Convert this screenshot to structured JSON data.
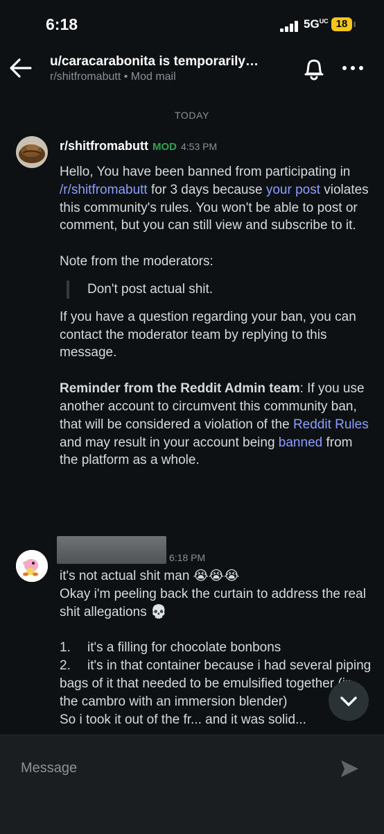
{
  "status_bar": {
    "time": "6:18",
    "network": "5G",
    "network_sup": "UC",
    "battery": "18"
  },
  "header": {
    "title": "u/caracarabonita is temporarily…",
    "subtitle": "r/shitfromabutt • Mod mail",
    "icons": [
      "back-arrow-icon",
      "bell-icon",
      "more-horizontal-icon"
    ]
  },
  "day_label": "TODAY",
  "messages": [
    {
      "sender": "r/shitfromabutt",
      "badge": "MOD",
      "time": "4:53 PM",
      "p1": {
        "t1": "Hello, You have been banned from participating in ",
        "link1": "/r/shitfromabutt",
        "t2": " for 3 days because ",
        "link2": "your post",
        "t3": " violates this community's rules. You won't be able to post or comment, but you can still view and subscribe to it."
      },
      "p2": "Note from the moderators:",
      "quote": "Don't post actual shit.",
      "p3": "If you have a question regarding your ban, you can contact the moderator team by replying to this message.",
      "p4": {
        "bold": "Reminder from the Reddit Admin team",
        "t1": ": If you use another account to circumvent this community ban, that will be considered a violation of the ",
        "link1": "Reddit Rules",
        "t2": " and may result in your account being ",
        "link2": "banned",
        "t3": " from the platform as a whole."
      }
    },
    {
      "sender_hidden": true,
      "time": "6:18 PM",
      "line1": "it's not actual shit man 😭😭😭",
      "line2": "Okay i'm peeling back the curtain to address the real shit allegations 💀",
      "list": [
        {
          "num": "1.",
          "text": "it's a filling for chocolate bonbons"
        },
        {
          "num": "2.",
          "text": "it's in that container because i had several piping bags of it that needed to be emulsified together (in the cambro with an immersion blender)"
        }
      ],
      "cut_line": "So i took it out of the fr... and it was solid..."
    }
  ],
  "composer": {
    "placeholder": "Message"
  },
  "colors": {
    "background": "#0e1113",
    "link": "#8c9eff",
    "mod_badge": "#2fa44f",
    "battery": "#f5c518"
  }
}
